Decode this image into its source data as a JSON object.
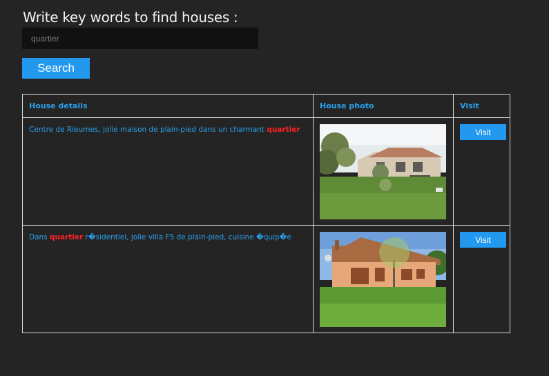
{
  "search": {
    "heading": "Write key words to find houses :",
    "value": "quartier",
    "button_label": "Search"
  },
  "table": {
    "headers": [
      "House details",
      "House photo",
      "Visit"
    ],
    "rows": [
      {
        "details_before": "Centre de Rieumes, jolie maison de plain-pied dans un charmant ",
        "keyword": "quartier",
        "details_after": "",
        "photo": "house-photo-1",
        "visit_label": "Visit"
      },
      {
        "details_before": "Dans ",
        "keyword": "quartier",
        "details_after": " r�sidentiel, jolie villa F5 de plain-pied, cuisine �quip�e",
        "photo": "house-photo-2",
        "visit_label": "Visit"
      }
    ]
  },
  "colors": {
    "background": "#242424",
    "accent": "#2299ee",
    "keyword_highlight": "#ff2222"
  }
}
